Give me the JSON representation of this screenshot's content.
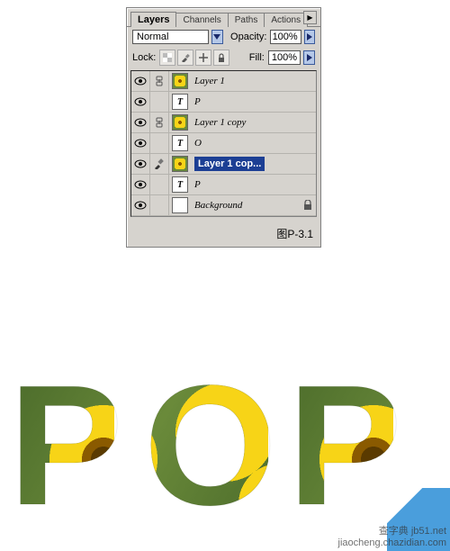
{
  "panel": {
    "tabs": [
      "Layers",
      "Channels",
      "Paths",
      "Actions"
    ],
    "active_tab": 0,
    "blend_mode": "Normal",
    "opacity_label": "Opacity:",
    "opacity_value": "100%",
    "lock_label": "Lock:",
    "fill_label": "Fill:",
    "fill_value": "100%",
    "caption": "图P-3.1"
  },
  "layers": [
    {
      "visible": true,
      "linked": true,
      "thumb": "flower-checker",
      "name": "Layer 1",
      "selected": false,
      "text": false,
      "locked": false
    },
    {
      "visible": true,
      "linked": false,
      "thumb": "text",
      "name": "P",
      "selected": false,
      "text": true,
      "locked": false
    },
    {
      "visible": true,
      "linked": true,
      "thumb": "flower-checker",
      "name": "Layer 1 copy",
      "selected": false,
      "text": false,
      "locked": false
    },
    {
      "visible": true,
      "linked": false,
      "thumb": "text",
      "name": "O",
      "selected": false,
      "text": true,
      "locked": false
    },
    {
      "visible": true,
      "linked": true,
      "thumb": "flower-checker",
      "name": "Layer 1 cop...",
      "selected": true,
      "text": false,
      "locked": false
    },
    {
      "visible": true,
      "linked": false,
      "thumb": "text",
      "name": "P",
      "selected": false,
      "text": true,
      "locked": false
    },
    {
      "visible": true,
      "linked": false,
      "thumb": "white",
      "name": "Background",
      "selected": false,
      "text": false,
      "locked": true
    }
  ],
  "pop_text": {
    "p1": "P",
    "o": "O",
    "p2": "P"
  },
  "watermark": {
    "line1": "查字典 jb51.net",
    "line2": "jiaocheng.chazidian.com"
  },
  "icons": {
    "menu": "▶",
    "chevron_down": "chev",
    "slider": "▸",
    "eye": "eye",
    "brush": "brush",
    "link": "link",
    "lock": "lock",
    "transparency": "trans",
    "plus": "plus"
  }
}
